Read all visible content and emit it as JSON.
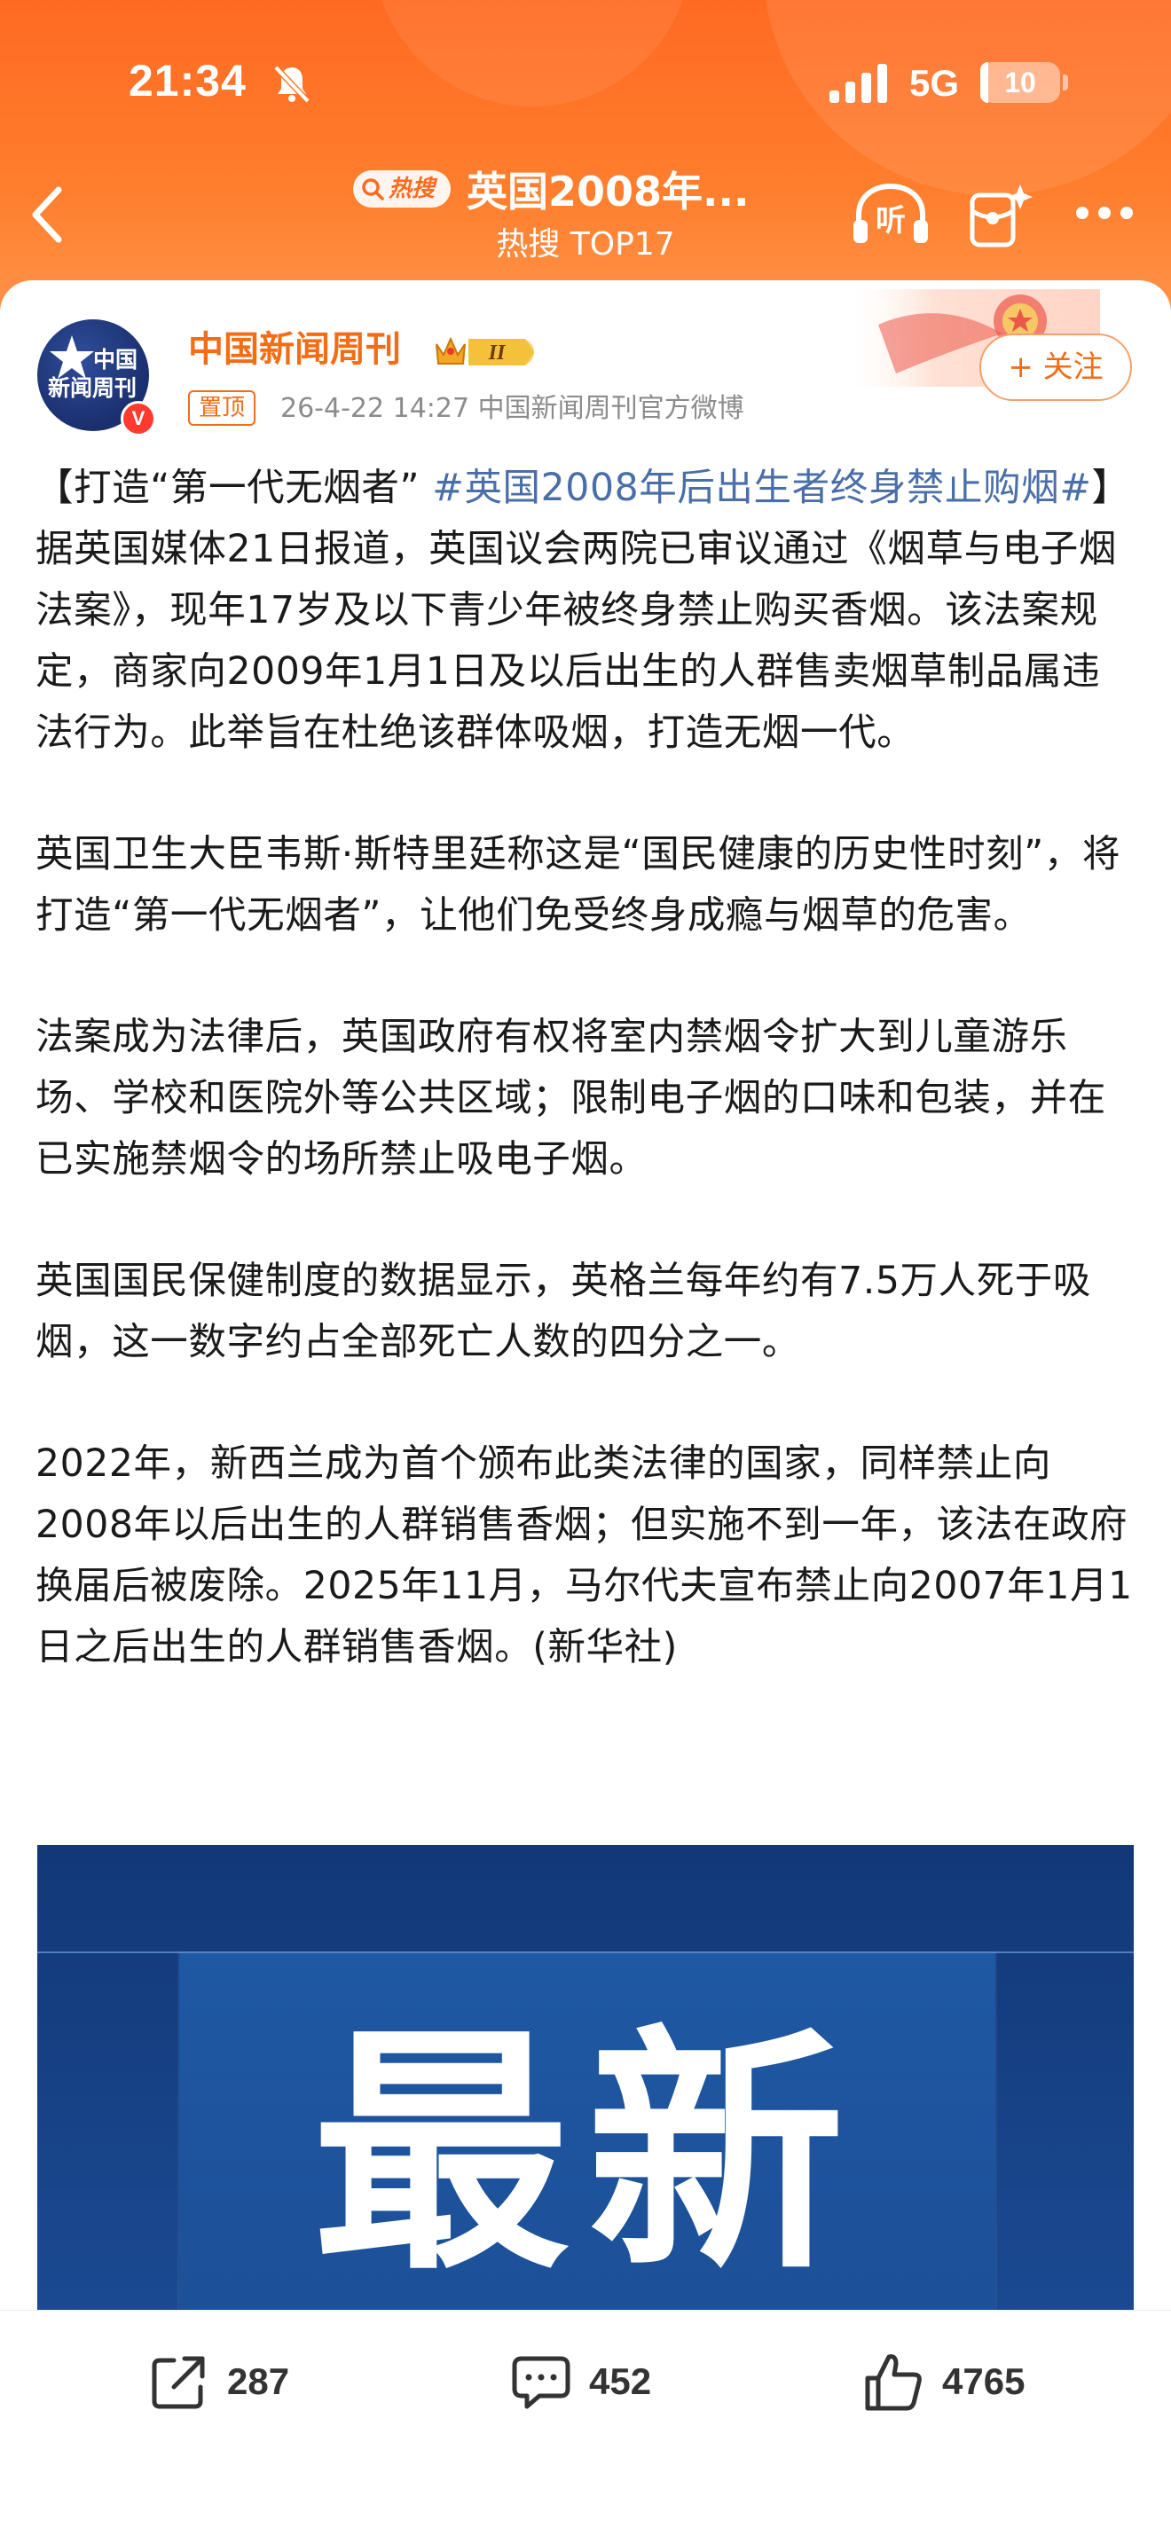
{
  "status_bar": {
    "time": "21:34",
    "network": "5G",
    "battery_level": "10",
    "battery_fraction": 0.1
  },
  "nav": {
    "hot_badge_label": "热搜",
    "title": "英国2008年...",
    "subtitle": "热搜 TOP17",
    "listen_label": "听"
  },
  "author": {
    "avatar_text_top": "中国",
    "avatar_text_bottom": "新闻周刊",
    "verified_mark": "V",
    "name": "中国新闻周刊",
    "vip_level": "II",
    "pin_label": "置顶",
    "meta": "26-4-22 14:27  中国新闻周刊官方微博",
    "follow_label": "+ 关注"
  },
  "post": {
    "p1_prefix": "【打造“第一代无烟者” ",
    "p1_hashtag": "#英国2008年后出生者终身禁止购烟#",
    "p1_rest": "】据英国媒体21日报道，英国议会两院已审议通过《烟草与电子烟法案》，现年17岁及以下青少年被终身禁止购买香烟。该法案规定，商家向2009年1月1日及以后出生的人群售卖烟草制品属违法行为。此举旨在杜绝该群体吸烟，打造无烟一代。",
    "p2": "英国卫生大臣韦斯·斯特里廷称这是“国民健康的历史性时刻”，将打造“第一代无烟者”，让他们免受终身成瘾与烟草的危害。",
    "p3": "法案成为法律后，英国政府有权将室内禁烟令扩大到儿童游乐场、学校和医院外等公共区域；限制电子烟的口味和包装，并在已实施禁烟令的场所禁止吸电子烟。",
    "p4": "英国国民保健制度的数据显示，英格兰每年约有7.5万人死于吸烟，这一数字约占全部死亡人数的四分之一。",
    "p5": "2022年，新西兰成为首个颁布此类法律的国家，同样禁止向2008年以后出生的人群销售香烟；但实施不到一年，该法在政府换届后被废除。2025年11月，马尔代夫宣布禁止向2007年1月1日之后出生的人群销售香烟。(新华社)",
    "image_text": "最新"
  },
  "actions": {
    "repost_count": "287",
    "comment_count": "452",
    "like_count": "4765"
  },
  "colors": {
    "header_orange": "#ff6a22",
    "author_orange": "#f36d16",
    "hashtag_blue": "#4a6ea8",
    "image_blue": "#1b4a92"
  },
  "icons": [
    "mute-icon",
    "signal-icon",
    "back-icon",
    "search-icon",
    "listen-icon",
    "red-packet-icon",
    "more-icon",
    "star-icon",
    "crown-icon",
    "repost-icon",
    "comment-icon",
    "like-icon"
  ]
}
